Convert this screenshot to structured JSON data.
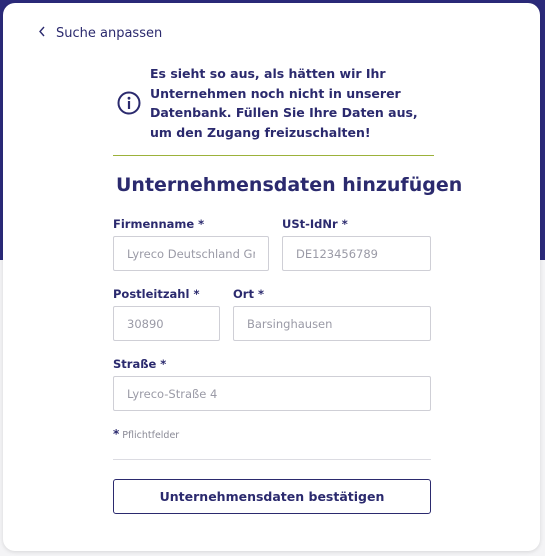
{
  "colors": {
    "brand": "#2b2a7a",
    "text": "#2b2a6e",
    "accent_line": "#9cb23a"
  },
  "back_link": {
    "label": "Suche anpassen",
    "icon": "chevron-left-icon"
  },
  "notice": {
    "icon": "info-icon",
    "message": "Es sieht so aus, als hätten wir Ihr Unternehmen noch nicht in unserer Datenbank. Füllen Sie Ihre Daten aus, um den Zugang freizuschalten!"
  },
  "form": {
    "title": "Unternehmensdaten hinzufügen",
    "fields": {
      "company": {
        "label": "Firmenname *",
        "value": "",
        "placeholder": "Lyreco Deutschland GmbH"
      },
      "vat": {
        "label": "USt-IdNr *",
        "value": "",
        "placeholder": "DE123456789"
      },
      "zip": {
        "label": "Postleitzahl *",
        "value": "",
        "placeholder": "30890"
      },
      "city": {
        "label": "Ort *",
        "value": "",
        "placeholder": "Barsinghausen"
      },
      "street": {
        "label": "Straße *",
        "value": "",
        "placeholder": "Lyreco-Straße 4"
      }
    },
    "required_star": "*",
    "required_note": "Pflichtfelder",
    "submit_label": "Unternehmensdaten bestätigen"
  }
}
